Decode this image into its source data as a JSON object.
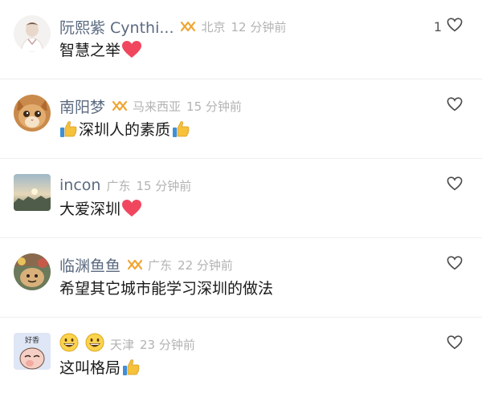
{
  "comments": [
    {
      "name": "阮熙紫 Cynthi...",
      "location": "北京",
      "time": "12 分钟前",
      "text": "智慧之举",
      "likes": "1",
      "text_icon": "heart-emoji"
    },
    {
      "name": "南阳梦",
      "location": "马来西亚",
      "time": "15 分钟前",
      "text": "深圳人的素质",
      "likes": "",
      "text_icon": "thumbs-up-emoji"
    },
    {
      "name": "incon",
      "location": "广东",
      "time": "15 分钟前",
      "text": "大爱深圳",
      "likes": "",
      "text_icon": "heart-emoji"
    },
    {
      "name": "临渊鱼鱼",
      "location": "广东",
      "time": "22 分钟前",
      "text": "希望其它城市能学习深圳的做法",
      "likes": "",
      "text_icon": ""
    },
    {
      "name": "",
      "location": "天津",
      "time": "23 分钟前",
      "text": "这叫格局",
      "likes": "",
      "text_icon": "thumbs-up-emoji",
      "name_icons": [
        "grinning-face-emoji",
        "grinning-face-emoji"
      ],
      "avatar_text": "好香"
    }
  ],
  "colors": {
    "name": "#5b6a80",
    "meta": "#b3b3b3",
    "text": "#1a1a1a",
    "badge": "#f0a431",
    "heart": "#f0475e",
    "thumb": "#f6c13b"
  }
}
